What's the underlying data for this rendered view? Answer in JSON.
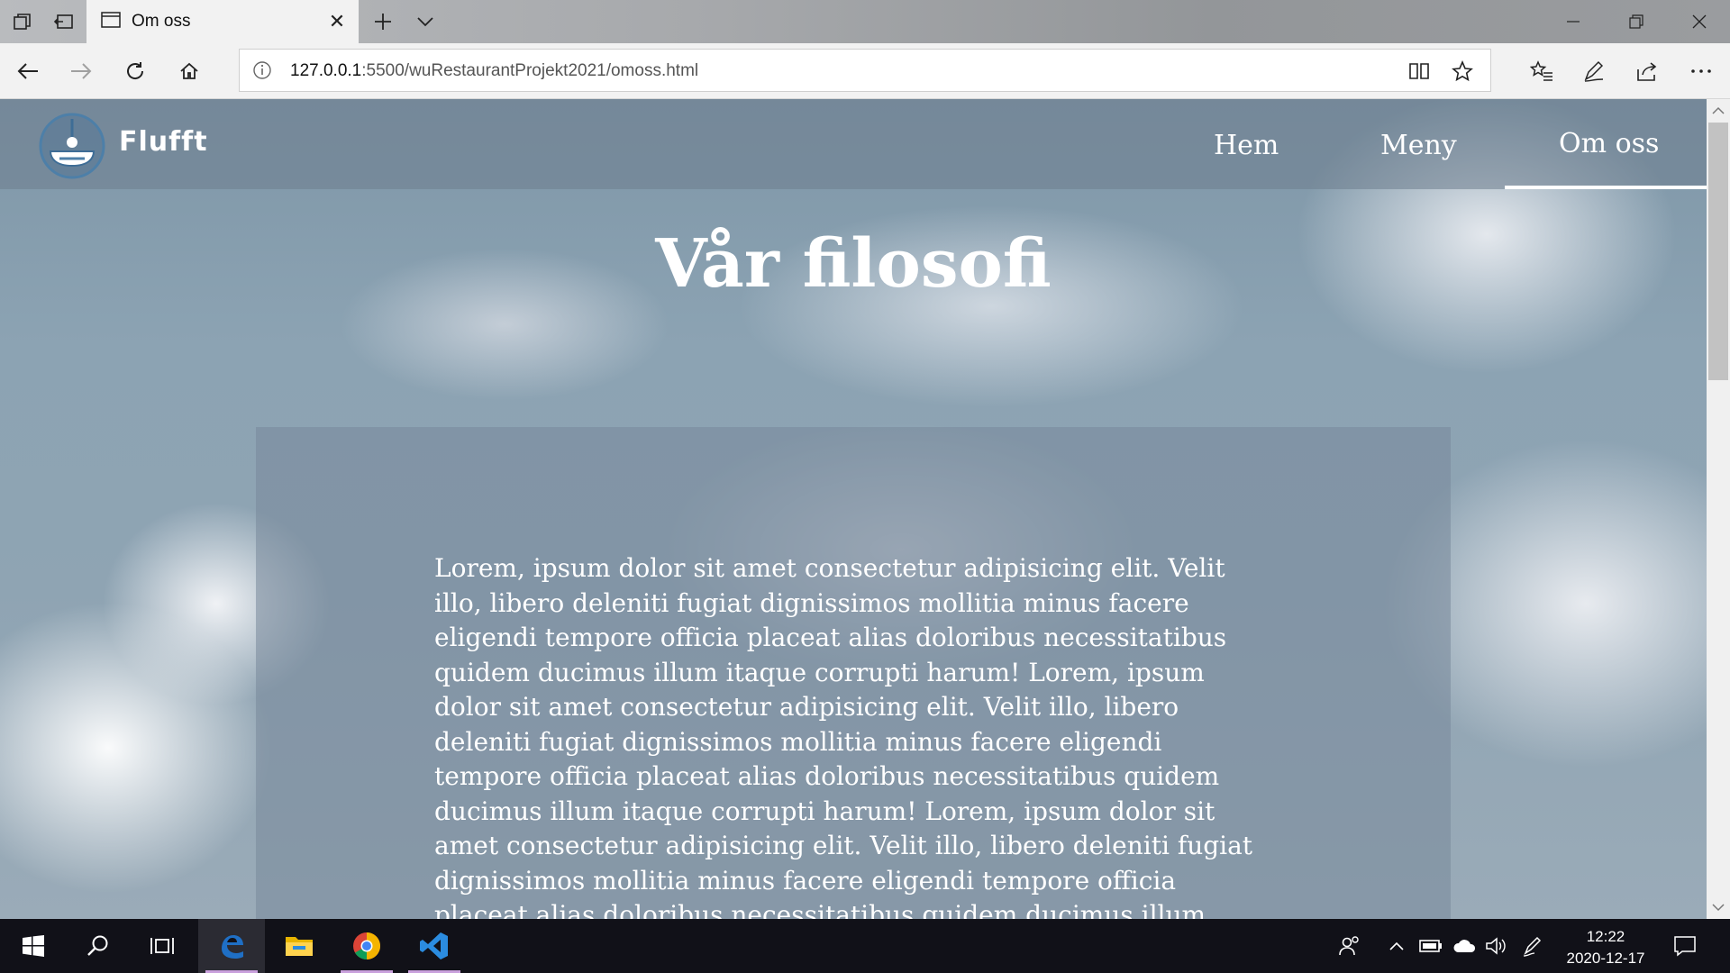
{
  "browser": {
    "tab_title": "Om oss",
    "url_host": "127.0.0.1",
    "url_path": ":5500/wuRestaurantProjekt2021/omoss.html"
  },
  "site": {
    "brand": "Flufft",
    "nav": [
      {
        "label": "Hem"
      },
      {
        "label": "Meny"
      },
      {
        "label": "Om oss",
        "active": true
      }
    ],
    "page_title": "Vår filosofi",
    "body_text": "Lorem, ipsum dolor sit amet consectetur adipisicing elit. Velit illo, libero deleniti fugiat dignissimos mollitia minus facere eligendi tempore officia placeat alias doloribus necessitatibus quidem ducimus illum itaque corrupti harum! Lorem, ipsum dolor sit amet consectetur adipisicing elit. Velit illo, libero deleniti fugiat dignissimos mollitia minus facere eligendi tempore officia placeat alias doloribus necessitatibus quidem ducimus illum itaque corrupti harum! Lorem, ipsum dolor sit amet consectetur adipisicing elit. Velit illo, libero deleniti fugiat dignissimos mollitia minus facere eligendi tempore officia placeat alias doloribus necessitatibus quidem ducimus illum itaque corrupti harum!"
  },
  "taskbar": {
    "time": "12:22",
    "date": "2020-12-17",
    "apps": [
      "start-icon",
      "search-icon",
      "task-view-icon",
      "edge-icon",
      "file-explorer-icon",
      "chrome-icon",
      "vscode-icon"
    ]
  },
  "colors": {
    "header_overlay": "#6e7d8e",
    "content_overlay": "#78889a",
    "taskbar": "#111118",
    "edge_blue": "#1f6fc5",
    "vscode_blue": "#2b8ce0"
  }
}
